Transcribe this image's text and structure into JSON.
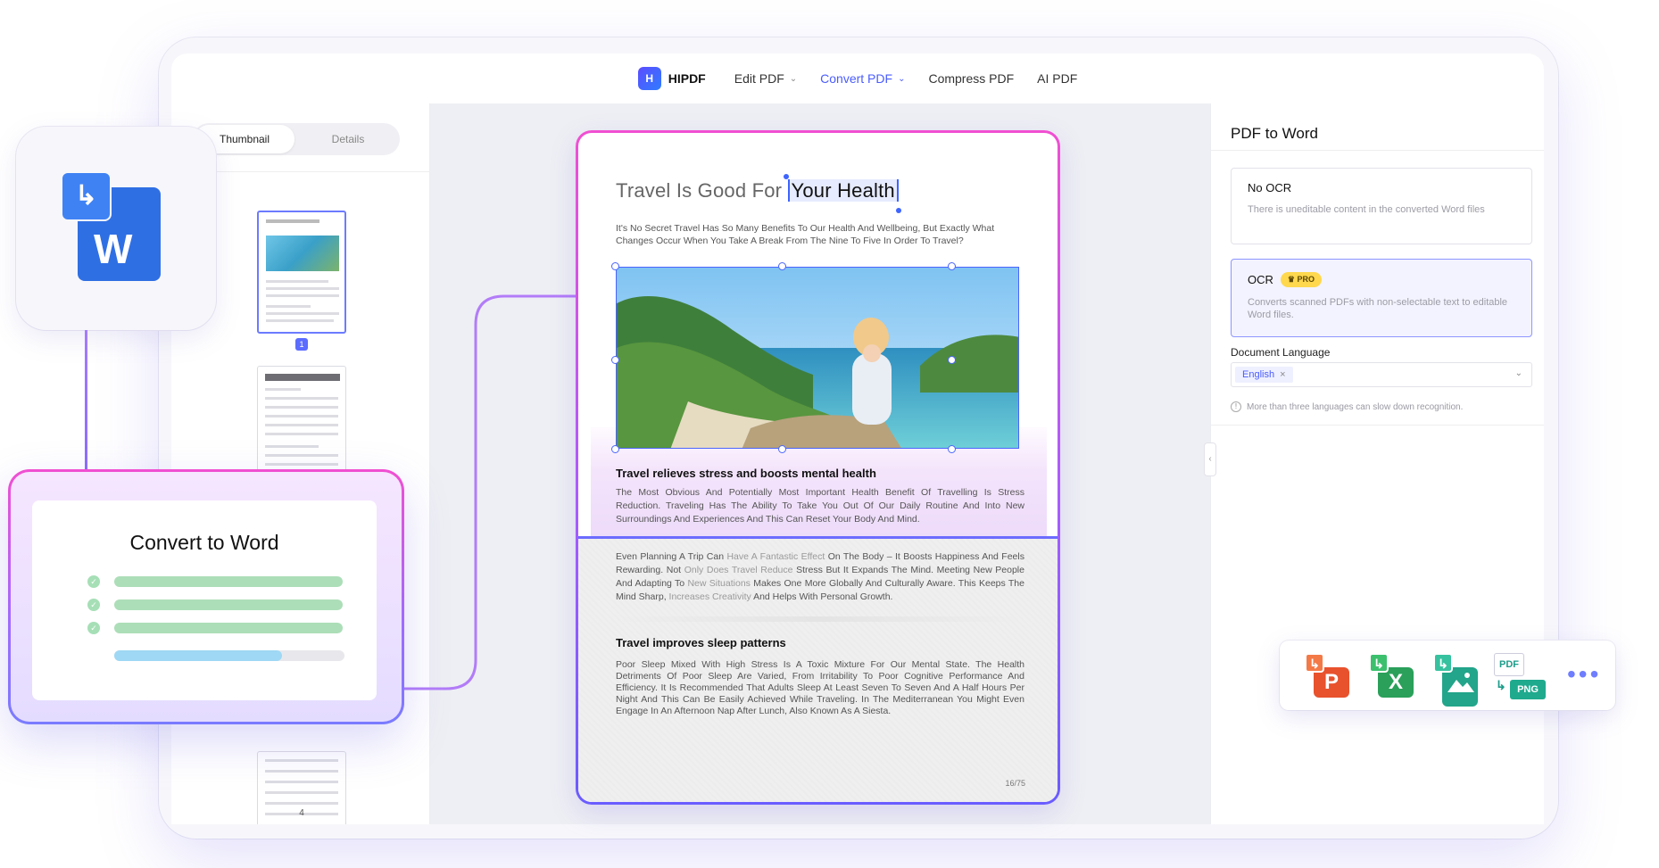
{
  "nav": {
    "logo": "HIPDF",
    "logo_mark": "H",
    "items": [
      "Edit PDF",
      "Convert PDF",
      "Compress PDF",
      "AI PDF"
    ],
    "chevron": "⌄"
  },
  "sidebar": {
    "tabs": [
      "Thumbnail",
      "Details"
    ],
    "selected_page": "1",
    "last_page": "4"
  },
  "document": {
    "title_plain": "Travel Is Good For",
    "title_selected": "Your Health",
    "intro": "It's No Secret Travel Has So Many Benefits To Our Health And Wellbeing, But Exactly What Changes Occur When You Take A Break From The Nine To Five In Order To Travel?",
    "section1_heading": "Travel relieves stress and boosts mental health",
    "section1_para": "The Most Obvious And Potentially Most Important Health Benefit Of Travelling Is Stress Reduction. Traveling Has The Ability To Take You Out Of Our Daily Routine And Into New Surroundings And Experiences And This Can Reset Your Body And Mind.",
    "para2": {
      "a": "Even Planning A Trip Can",
      "b": " Have A Fantastic Effect ",
      "c": "On The Body – It Boosts Happiness And Feels Rewarding. Not",
      "d": " Only Does Travel Reduce ",
      "e": "Stress But It Expands The Mind. Meeting New People And Adapting To",
      "f": " New Situations ",
      "g": "Makes One More Globally And Culturally Aware. This Keeps The Mind Sharp,",
      "h": " Increases Creativity ",
      "i": "And Helps With Personal Growth."
    },
    "section2_heading": "Travel improves sleep patterns",
    "section2_para": "Poor Sleep Mixed With High Stress Is A Toxic Mixture For Our Mental State. The Health Detriments Of Poor Sleep Are Varied, From Irritability To Poor Cognitive Performance And Efficiency. It Is Recommended That Adults Sleep At Least Seven To Seven And A Half Hours Per Night And This Can Be Easily Achieved While Traveling. In The Mediterranean You Might Even Engage In An Afternoon Nap After Lunch, Also Known As A Siesta.",
    "page_indicator": "16/75"
  },
  "panel": {
    "title": "PDF to Word",
    "options": [
      {
        "title": "No OCR",
        "desc": "There is uneditable content in the converted Word files"
      },
      {
        "title": "OCR",
        "badge": "♛ PRO",
        "desc": "Converts scanned PDFs with non-selectable text to editable Word files."
      }
    ],
    "language_label": "Document Language",
    "language_value": "English",
    "language_remove": "×",
    "hint": "More than three languages can slow down recognition.",
    "hint_icon": "!",
    "collapse_glyph": "‹"
  },
  "convert_card": {
    "title": "Convert to Word",
    "check_glyph": "✓",
    "progress": 0.73
  },
  "word_icon": {
    "front_glyph": "↳",
    "letter": "W"
  },
  "formats": {
    "ppt": {
      "arrow": "↳",
      "letter": "P"
    },
    "excel": {
      "arrow": "↳",
      "letter": "X"
    },
    "image": {
      "arrow": "↳"
    },
    "png": {
      "top": "PDF",
      "arrow": "↳",
      "bottom": "PNG"
    },
    "more": "•••"
  },
  "colors": {
    "accent": "#4a5cff",
    "ppt": "#e8522d",
    "excel": "#2aa05a",
    "image": "#22a58a",
    "word": "#2f6fe4"
  }
}
